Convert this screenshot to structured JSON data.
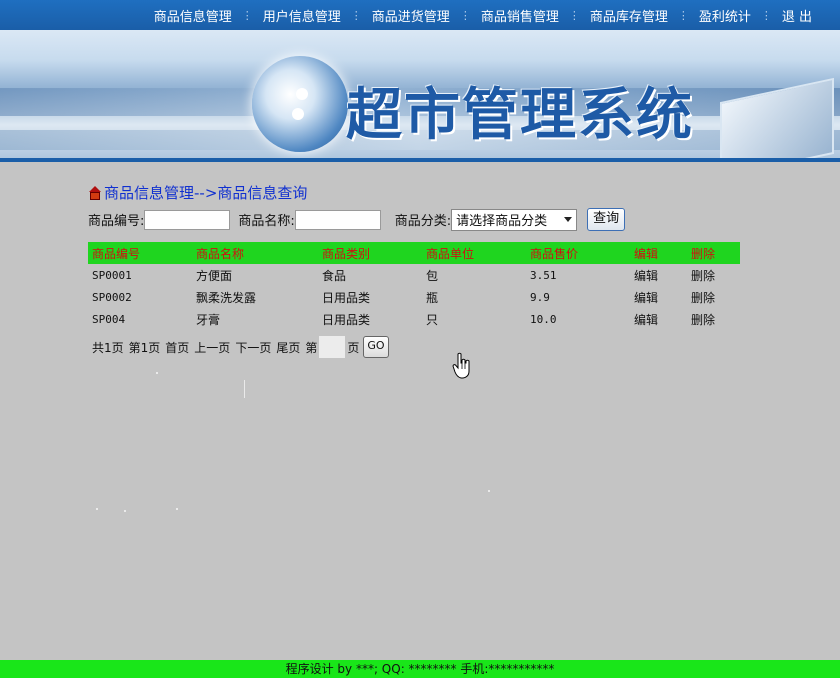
{
  "nav": {
    "items": [
      "商品信息管理",
      "用户信息管理",
      "商品进货管理",
      "商品销售管理",
      "商品库存管理",
      "盈利统计",
      "退 出"
    ],
    "separator": "⋮"
  },
  "banner": {
    "title": "超市管理系统"
  },
  "breadcrumb": "商品信息管理-->商品信息查询",
  "search": {
    "code_label": "商品编号:",
    "code_value": "",
    "name_label": "商品名称:",
    "name_value": "",
    "category_label": "商品分类:",
    "category_selected": "请选择商品分类",
    "query_label": "查询"
  },
  "table": {
    "headers": [
      "商品编号",
      "商品名称",
      "商品类别",
      "商品单位",
      "商品售价",
      "编辑",
      "删除"
    ],
    "rows": [
      {
        "code": "SP0001",
        "name": "方便面",
        "category": "食品",
        "unit": "包",
        "price": "3.51",
        "edit": "编辑",
        "delete": "删除"
      },
      {
        "code": "SP0002",
        "name": "飘柔洗发露",
        "category": "日用品类",
        "unit": "瓶",
        "price": "9.9",
        "edit": "编辑",
        "delete": "删除"
      },
      {
        "code": "SP004",
        "name": "牙膏",
        "category": "日用品类",
        "unit": "只",
        "price": "10.0",
        "edit": "编辑",
        "delete": "删除"
      }
    ]
  },
  "pager": {
    "total": "共1页",
    "current": "第1页",
    "first": "首页",
    "prev": "上一页",
    "next": "下一页",
    "last": "尾页",
    "goto_prefix": "第",
    "goto_suffix": "页",
    "go_label": "GO"
  },
  "footer": "程序设计 by ***; QQ: ******** 手机:***********",
  "colors": {
    "nav_bg": "#1a5ea8",
    "header_bg": "#1fd51f",
    "header_text": "#d01010",
    "footer_bg": "#19e619",
    "page_bg": "#c4c4c4",
    "title": "#1e5aa6"
  },
  "icons": [
    "home-icon",
    "chevron-down-icon",
    "hand-cursor-icon"
  ]
}
